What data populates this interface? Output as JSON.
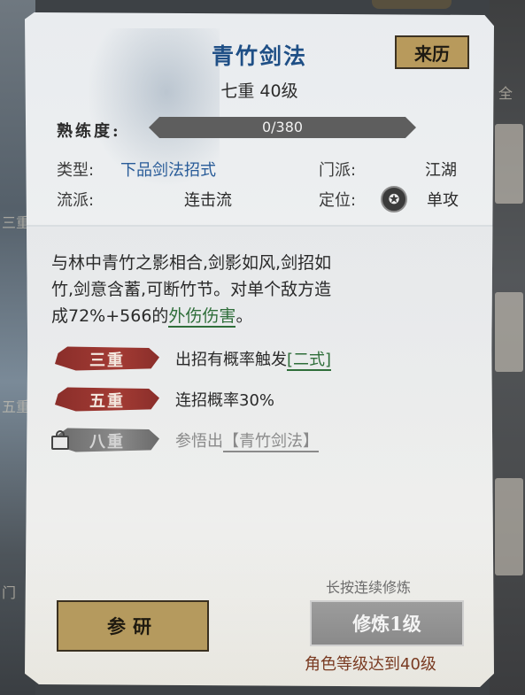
{
  "background": {
    "left_fragments": [
      "三重",
      "五重",
      "门"
    ],
    "right_fragments": [
      "全"
    ]
  },
  "skill": {
    "title": "青竹剑法",
    "level_text": "七重 40级",
    "origin_button": "来历"
  },
  "proficiency": {
    "label": "熟练度:",
    "current": 0,
    "max": 380,
    "text": "0/380"
  },
  "attributes": {
    "type_label": "类型:",
    "type_value": "下品剑法招式",
    "school_label": "门派:",
    "school_value": "江湖",
    "style_label": "流派:",
    "style_value": "连击流",
    "role_label": "定位:",
    "role_icon": "single-target-icon",
    "role_value": "单攻"
  },
  "description": {
    "line1": "与林中青竹之影相合,剑影如风,剑招如",
    "line2": "竹,剑意含蓄,可断竹节。对单个敌方造",
    "line3_prefix": "成72%+566的",
    "line3_link": "外伤伤害",
    "line3_suffix": "。"
  },
  "tiers": [
    {
      "label": "三重",
      "text": "出招有概率触发",
      "link": "[二式]",
      "unlocked": true
    },
    {
      "label": "五重",
      "text": "连招概率30%",
      "link": "",
      "unlocked": true
    },
    {
      "label": "八重",
      "text": "参悟出",
      "link": "【青竹剑法】",
      "unlocked": false
    }
  ],
  "actions": {
    "hint": "长按连续修炼",
    "study_button": "参研",
    "train_button": "修炼1级",
    "requirement": "角色等级达到40级"
  },
  "colors": {
    "title_blue": "#1f4f86",
    "value_blue": "#285b98",
    "link_green": "#2f6e3a",
    "tier_red": "#a33b34",
    "gold_button": "#b59a5e",
    "requirement_brown": "#7a3b22"
  }
}
